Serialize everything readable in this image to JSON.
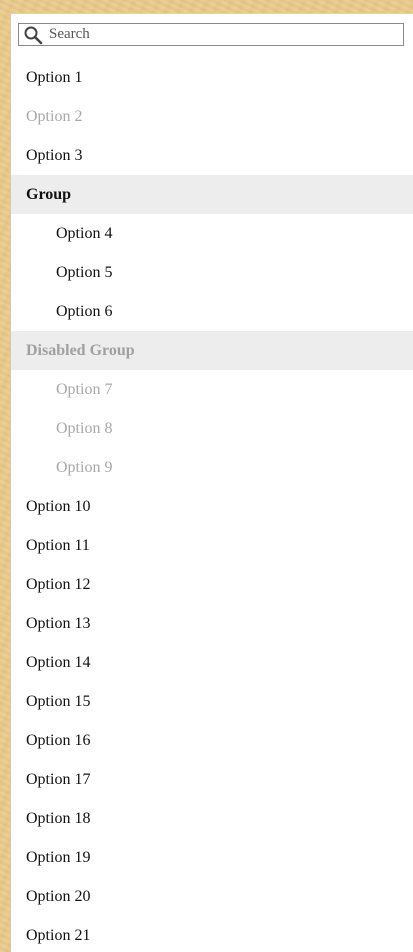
{
  "search": {
    "placeholder": "Search",
    "icon": "search-icon"
  },
  "items": [
    {
      "label": "Option 1",
      "kind": "option",
      "disabled": false,
      "child": false
    },
    {
      "label": "Option 2",
      "kind": "option",
      "disabled": true,
      "child": false
    },
    {
      "label": "Option 3",
      "kind": "option",
      "disabled": false,
      "child": false
    },
    {
      "label": "Group",
      "kind": "group",
      "disabled": false,
      "child": false
    },
    {
      "label": "Option 4",
      "kind": "option",
      "disabled": false,
      "child": true
    },
    {
      "label": "Option 5",
      "kind": "option",
      "disabled": false,
      "child": true
    },
    {
      "label": "Option 6",
      "kind": "option",
      "disabled": false,
      "child": true
    },
    {
      "label": "Disabled Group",
      "kind": "group",
      "disabled": true,
      "child": false
    },
    {
      "label": "Option 7",
      "kind": "option",
      "disabled": true,
      "child": true
    },
    {
      "label": "Option 8",
      "kind": "option",
      "disabled": true,
      "child": true
    },
    {
      "label": "Option 9",
      "kind": "option",
      "disabled": true,
      "child": true
    },
    {
      "label": "Option 10",
      "kind": "option",
      "disabled": false,
      "child": false
    },
    {
      "label": "Option 11",
      "kind": "option",
      "disabled": false,
      "child": false
    },
    {
      "label": "Option 12",
      "kind": "option",
      "disabled": false,
      "child": false
    },
    {
      "label": "Option 13",
      "kind": "option",
      "disabled": false,
      "child": false
    },
    {
      "label": "Option 14",
      "kind": "option",
      "disabled": false,
      "child": false
    },
    {
      "label": "Option 15",
      "kind": "option",
      "disabled": false,
      "child": false
    },
    {
      "label": "Option 16",
      "kind": "option",
      "disabled": false,
      "child": false
    },
    {
      "label": "Option 17",
      "kind": "option",
      "disabled": false,
      "child": false
    },
    {
      "label": "Option 18",
      "kind": "option",
      "disabled": false,
      "child": false
    },
    {
      "label": "Option 19",
      "kind": "option",
      "disabled": false,
      "child": false
    },
    {
      "label": "Option 20",
      "kind": "option",
      "disabled": false,
      "child": false
    },
    {
      "label": "Option 21",
      "kind": "option",
      "disabled": false,
      "child": false
    }
  ],
  "colors": {
    "text": "#111111",
    "disabled_text": "#a8a8a8",
    "group_background": "#ededed",
    "page_background": "#e9c98a"
  }
}
